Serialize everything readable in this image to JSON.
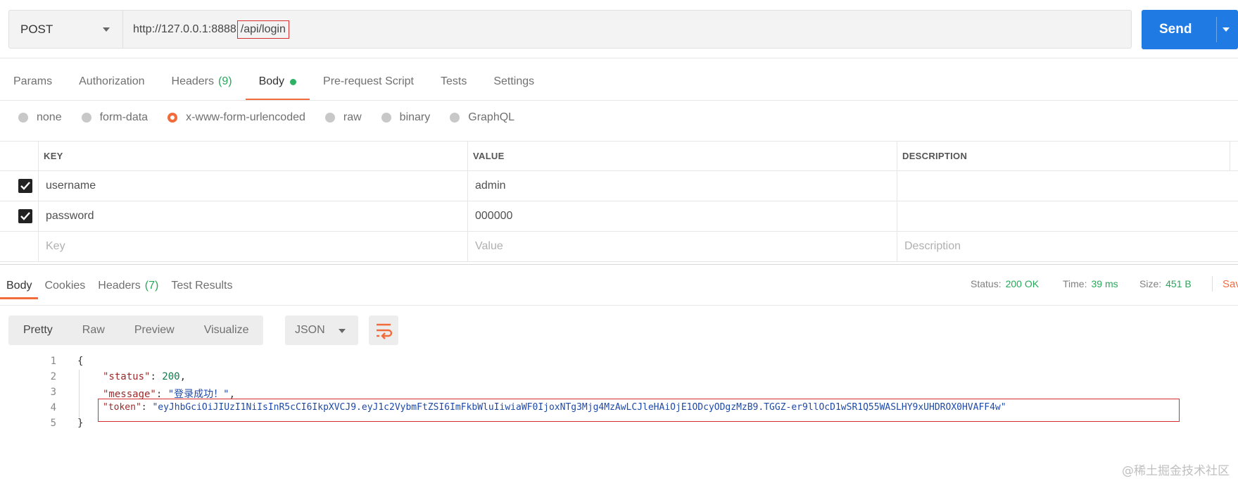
{
  "request": {
    "method": "POST",
    "url_base": "http://127.0.0.1:8888",
    "url_path": "/api/login",
    "send_label": "Send"
  },
  "request_tabs": [
    {
      "label": "Params"
    },
    {
      "label": "Authorization"
    },
    {
      "label": "Headers",
      "count": "(9)"
    },
    {
      "label": "Body",
      "active": true,
      "indicator": "green-dot"
    },
    {
      "label": "Pre-request Script"
    },
    {
      "label": "Tests"
    },
    {
      "label": "Settings"
    }
  ],
  "body_types": [
    "none",
    "form-data",
    "x-www-form-urlencoded",
    "raw",
    "binary",
    "GraphQL"
  ],
  "body_type_selected": "x-www-form-urlencoded",
  "kv_table": {
    "headers": [
      "KEY",
      "VALUE",
      "DESCRIPTION"
    ],
    "rows": [
      {
        "checked": true,
        "key": "username",
        "value": "admin",
        "description": ""
      },
      {
        "checked": true,
        "key": "password",
        "value": "000000",
        "description": ""
      }
    ],
    "placeholder": {
      "key": "Key",
      "value": "Value",
      "description": "Description"
    }
  },
  "response_tabs": [
    {
      "label": "Body",
      "active": true
    },
    {
      "label": "Cookies"
    },
    {
      "label": "Headers",
      "count": "(7)"
    },
    {
      "label": "Test Results"
    }
  ],
  "response_status": {
    "status_label": "Status:",
    "status_value": "200 OK",
    "time_label": "Time:",
    "time_value": "39 ms",
    "size_label": "Size:",
    "size_value": "451 B",
    "save_label": "Sav"
  },
  "view_modes": [
    "Pretty",
    "Raw",
    "Preview",
    "Visualize"
  ],
  "view_mode_selected": "Pretty",
  "format": "JSON",
  "response_body": {
    "line_numbers": [
      "1",
      "2",
      "3",
      "4",
      "5"
    ],
    "open_brace": "{",
    "close_brace": "}",
    "status_key": "\"status\"",
    "status_value": "200",
    "message_key": "\"message\"",
    "message_value": "\"登录成功！\"",
    "token_key": "\"token\"",
    "token_value": "\"eyJhbGciOiJIUzI1NiIsInR5cCI6IkpXVCJ9.eyJ1c2VybmFtZSI6ImFkbWluIiwiaWF0IjoxNTg3Mjg4MzAwLCJleHAiOjE1ODcyODgzMzB9.TGGZ-er9llOcD1wSR1Q55WASLHY9xUHDROX0HVAFF4w\""
  },
  "watermark": "@稀土掘金技术社区",
  "colors": {
    "accent": "#f26b3a",
    "send": "#1f7ae3",
    "success": "#26a85a",
    "highlight": "#d62e2e"
  }
}
